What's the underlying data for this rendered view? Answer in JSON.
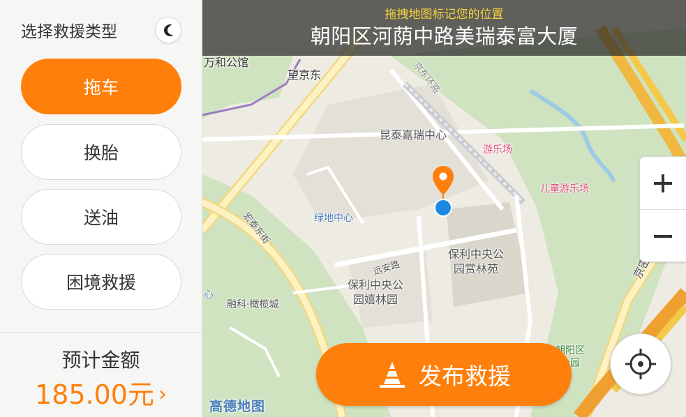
{
  "banner": {
    "hint": "拖拽地图标记您的位置",
    "address": "朝阳区河荫中路美瑞泰富大厦"
  },
  "sidebar": {
    "title": "选择救援类型",
    "night_mode_icon": "moon-icon",
    "types": [
      {
        "label": "拖车",
        "active": true
      },
      {
        "label": "换胎",
        "active": false
      },
      {
        "label": "送油",
        "active": false
      },
      {
        "label": "困境救援",
        "active": false
      }
    ],
    "estimate_label": "预计金额",
    "estimate_value": "185.00元",
    "estimate_chevron": "›"
  },
  "publish_button": {
    "label": "发布救援",
    "icon": "traffic-cone-icon"
  },
  "map_controls": {
    "zoom_in_icon": "plus-icon",
    "zoom_out_icon": "minus-icon",
    "locate_icon": "crosshair-icon"
  },
  "map": {
    "logo": "高德地图",
    "labels": {
      "wanhe": "万和公馆",
      "wangjingdong": "望京东",
      "kuntai": "昆泰嘉瑞中心",
      "youlechang": "游乐场",
      "ertong": "儿童游乐场",
      "hongtai": "宏泰东街",
      "lvdi": "绿地中心",
      "yuanan": "远安路",
      "baoli_shanglin": "保利中央公\n园赏林苑",
      "baoli_xilin": "保利中央公\n园嬉林园",
      "rongke": "融科·橄榄城",
      "jingmi": "京密路",
      "chaoyang_park": "朝阳区\n公园",
      "jingdong_rail": "京东环路",
      "xin": "心"
    }
  },
  "colors": {
    "accent": "#fe7f0b",
    "location_pin": "#fe7f0b",
    "location_dot": "#1e88e5",
    "banner_hint": "#f4d23c"
  }
}
